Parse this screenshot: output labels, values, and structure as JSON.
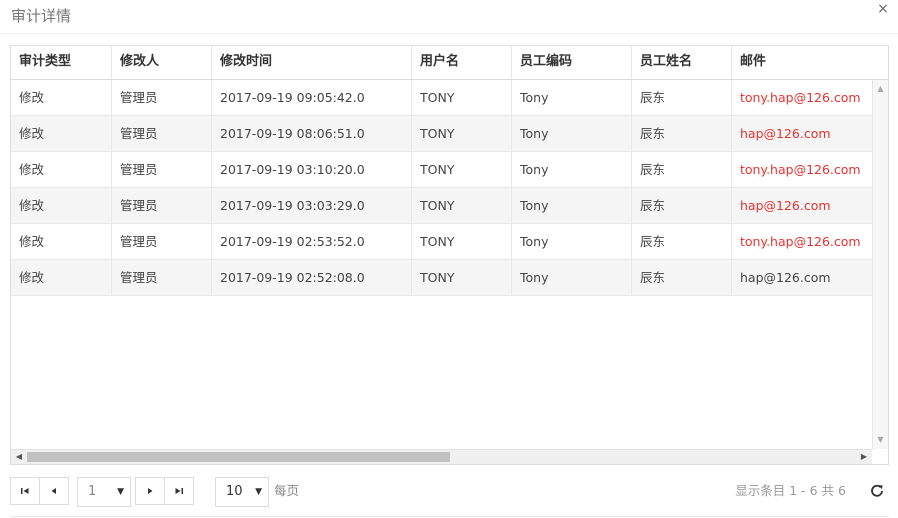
{
  "dialog": {
    "title": "审计详情",
    "close_label": "×"
  },
  "table": {
    "columns": [
      "审计类型",
      "修改人",
      "修改时间",
      "用户名",
      "员工编码",
      "员工姓名",
      "邮件"
    ],
    "rows": [
      {
        "type": "修改",
        "modifier": "管理员",
        "time": "2017-09-19 09:05:42.0",
        "username": "TONY",
        "emp_code": "Tony",
        "emp_name": "辰东",
        "email": "tony.hap@126.com",
        "email_changed": true
      },
      {
        "type": "修改",
        "modifier": "管理员",
        "time": "2017-09-19 08:06:51.0",
        "username": "TONY",
        "emp_code": "Tony",
        "emp_name": "辰东",
        "email": "hap@126.com",
        "email_changed": true
      },
      {
        "type": "修改",
        "modifier": "管理员",
        "time": "2017-09-19 03:10:20.0",
        "username": "TONY",
        "emp_code": "Tony",
        "emp_name": "辰东",
        "email": "tony.hap@126.com",
        "email_changed": true
      },
      {
        "type": "修改",
        "modifier": "管理员",
        "time": "2017-09-19 03:03:29.0",
        "username": "TONY",
        "emp_code": "Tony",
        "emp_name": "辰东",
        "email": "hap@126.com",
        "email_changed": true
      },
      {
        "type": "修改",
        "modifier": "管理员",
        "time": "2017-09-19 02:53:52.0",
        "username": "TONY",
        "emp_code": "Tony",
        "emp_name": "辰东",
        "email": "tony.hap@126.com",
        "email_changed": true
      },
      {
        "type": "修改",
        "modifier": "管理员",
        "time": "2017-09-19 02:52:08.0",
        "username": "TONY",
        "emp_code": "Tony",
        "emp_name": "辰东",
        "email": "hap@126.com",
        "email_changed": false
      }
    ]
  },
  "pager": {
    "first_icon": "first-page-icon",
    "prev_icon": "prev-page-icon",
    "next_icon": "next-page-icon",
    "last_icon": "last-page-icon",
    "current_page": "1",
    "page_size": "10",
    "per_page_label": "每页",
    "info": "显示条目 1 - 6 共 6",
    "refresh_icon": "refresh-icon"
  },
  "colors": {
    "changed_text": "#e8322f",
    "alt_row": "#f5f5f5",
    "border": "#dddddd"
  }
}
